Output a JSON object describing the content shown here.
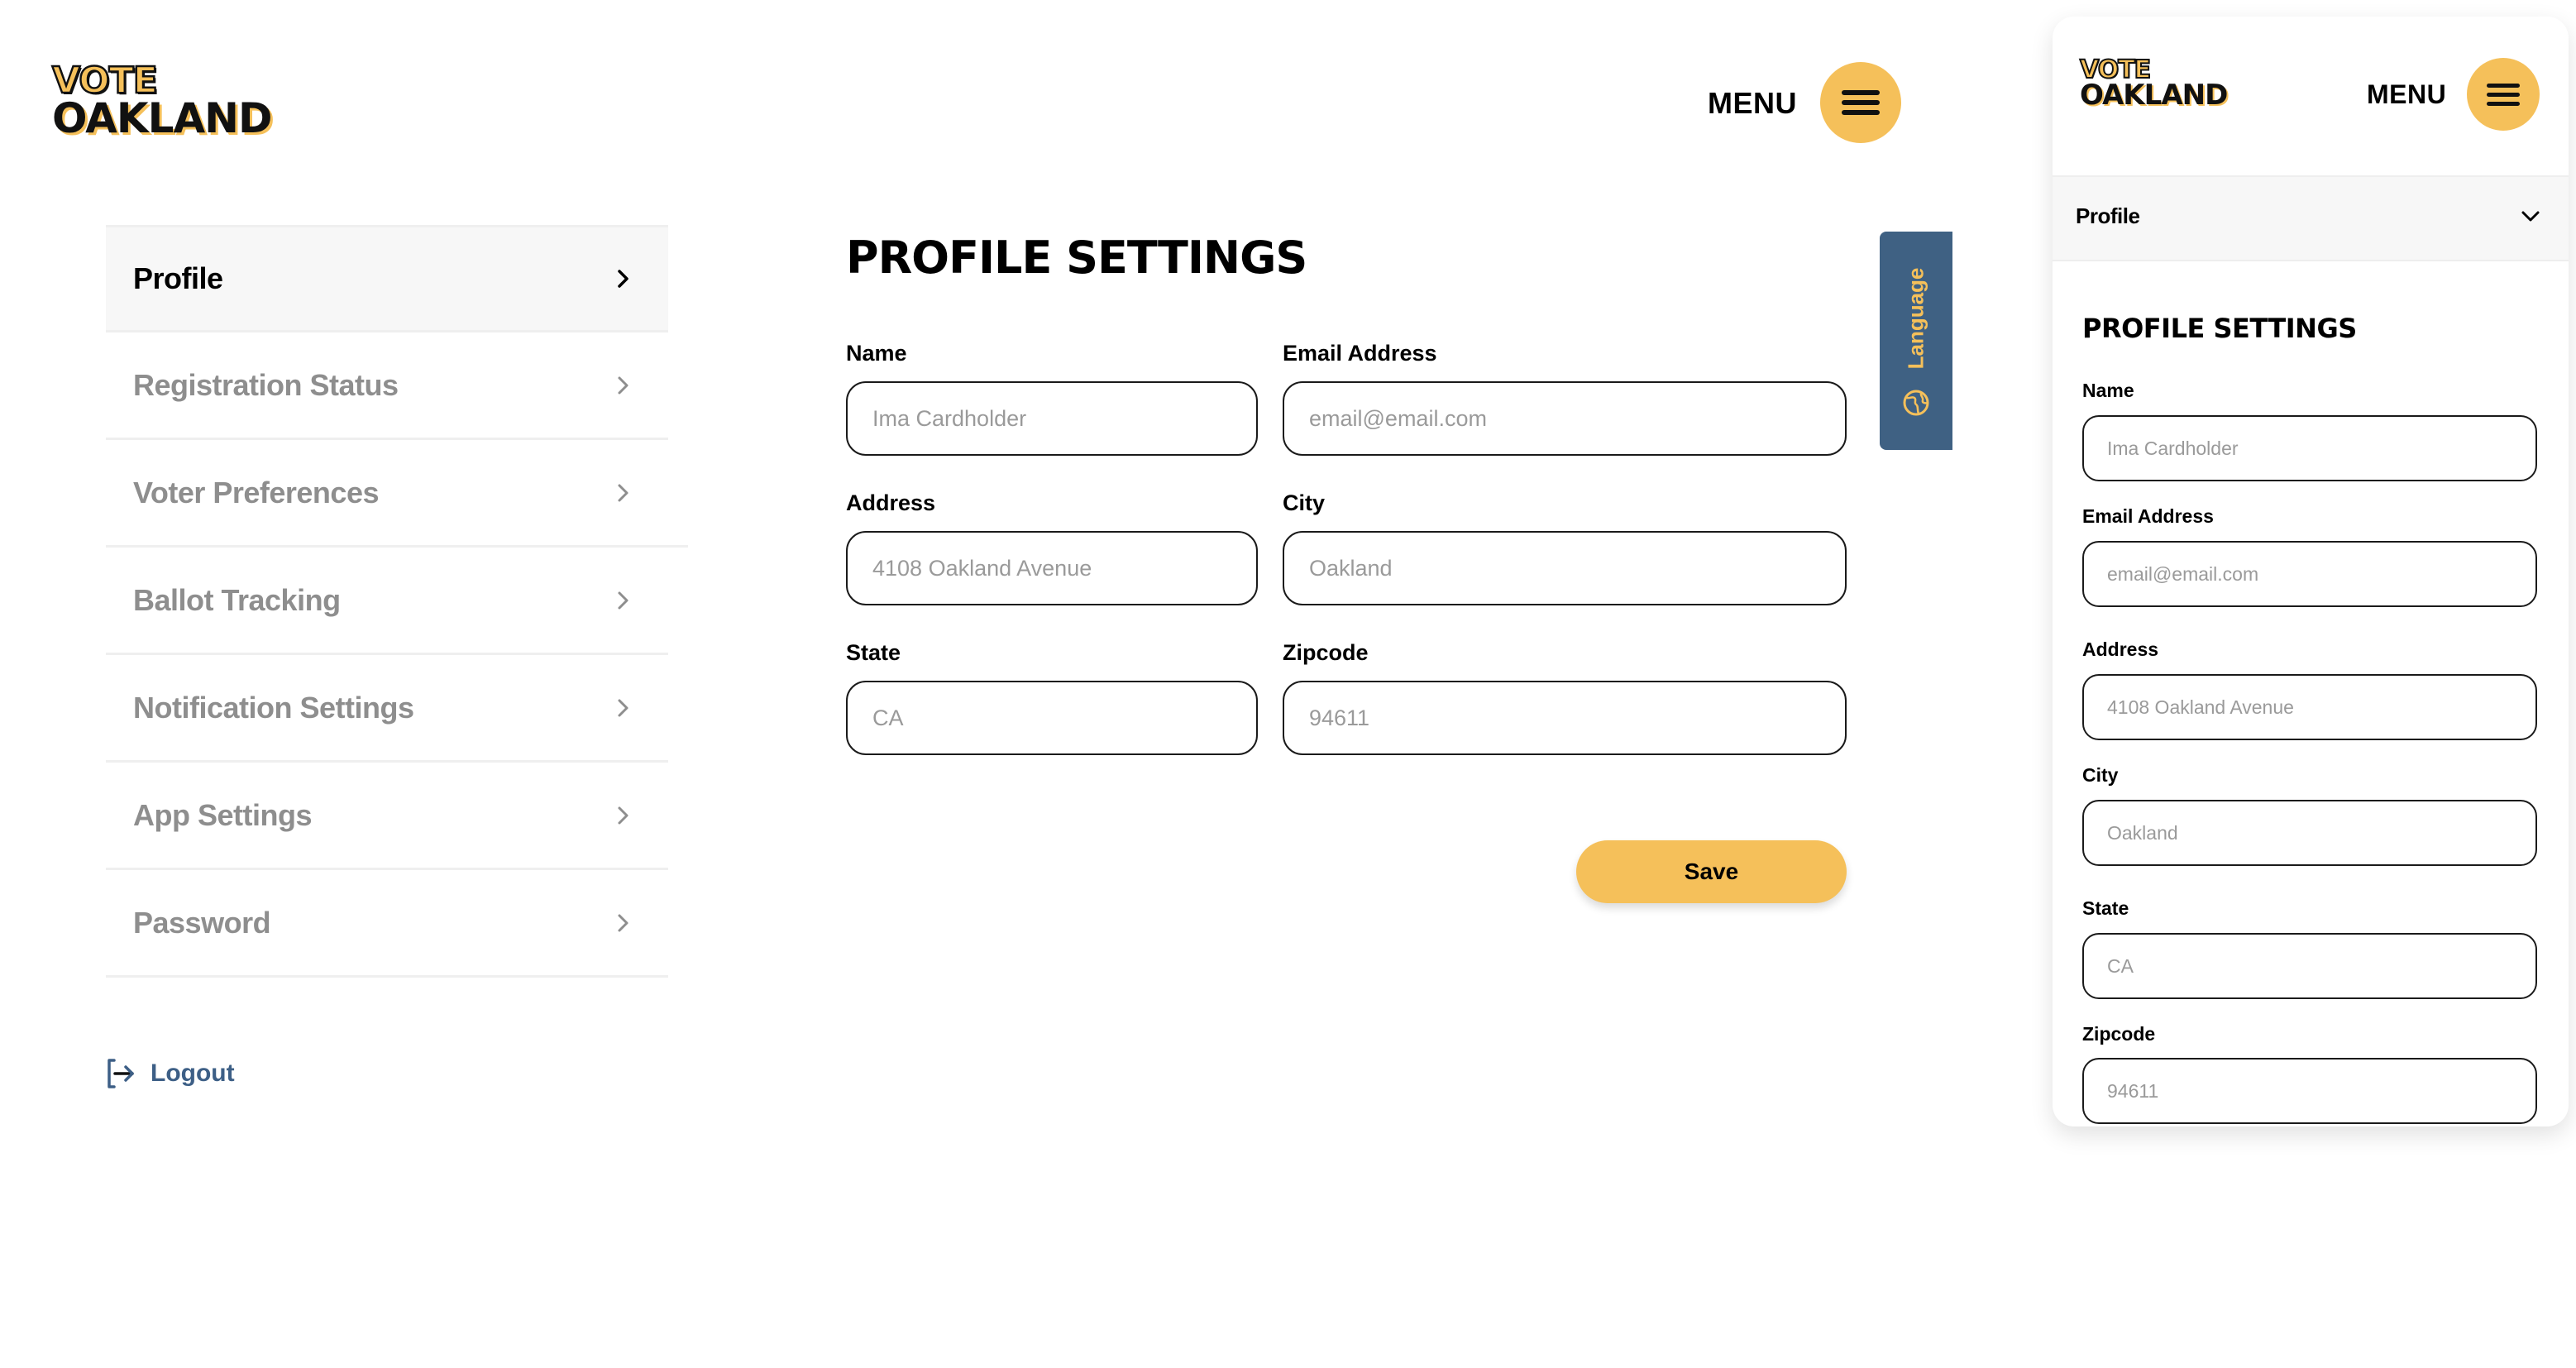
{
  "brand": {
    "line1": "VOTE",
    "line2": "OAKLAND",
    "accent": "#f5c05a",
    "secondary": "#3f6183"
  },
  "header": {
    "menu_label": "MENU",
    "menu_icon": "hamburger-icon"
  },
  "sidebar": {
    "items": [
      {
        "label": "Profile",
        "active": true
      },
      {
        "label": "Registration Status",
        "active": false
      },
      {
        "label": "Voter Preferences",
        "active": false
      },
      {
        "label": "Ballot Tracking",
        "active": false
      },
      {
        "label": "Notification Settings",
        "active": false
      },
      {
        "label": "App Settings",
        "active": false
      },
      {
        "label": "Password",
        "active": false
      }
    ],
    "logout_label": "Logout"
  },
  "main": {
    "title": "PROFILE SETTINGS",
    "fields": {
      "name": {
        "label": "Name",
        "placeholder": "Ima Cardholder",
        "value": ""
      },
      "email": {
        "label": "Email Address",
        "placeholder": "email@email.com",
        "value": ""
      },
      "address": {
        "label": "Address",
        "placeholder": "4108 Oakland Avenue",
        "value": ""
      },
      "city": {
        "label": "City",
        "placeholder": "Oakland",
        "value": ""
      },
      "state": {
        "label": "State",
        "placeholder": "CA",
        "value": ""
      },
      "zipcode": {
        "label": "Zipcode",
        "placeholder": "94611",
        "value": ""
      }
    },
    "save_label": "Save"
  },
  "language_tab": {
    "label": "Language",
    "icon": "globe-icon"
  },
  "mobile": {
    "menu_label": "MENU",
    "section_selector": "Profile",
    "title": "PROFILE SETTINGS"
  }
}
